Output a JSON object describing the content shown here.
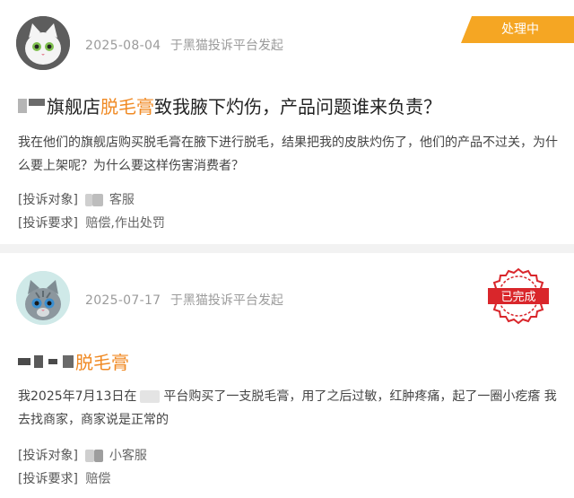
{
  "complaints": [
    {
      "date": "2025-08-04",
      "source": "于黑猫投诉平台发起",
      "status": "处理中",
      "title_mid": "旗舰店",
      "title_highlight": "脱毛膏",
      "title_tail": "致我腋下灼伤，产品问题谁来负责？",
      "body": "我在他们的旗舰店购买脱毛膏在腋下进行脱毛，结果把我的皮肤灼伤了，他们的产品不过关，为什么要上架呢？为什么要这样伤害消费者？",
      "target_label": "[投诉对象]",
      "target_value": "客服",
      "demand_label": "[投诉要求]",
      "demand_value": "赔偿,作出处罚"
    },
    {
      "date": "2025-07-17",
      "source": "于黑猫投诉平台发起",
      "status": "已完成",
      "title_highlight": "脱毛膏",
      "body_prefix": "我2025年7月13日在",
      "body_suffix": "平台购买了一支脱毛膏，用了之后过敏，红肿疼痛，起了一圈小疙瘩 我去找商家，商家说是正常的",
      "target_label": "[投诉对象]",
      "target_value": "小客服",
      "demand_label": "[投诉要求]",
      "demand_value": "赔偿"
    }
  ],
  "colors": {
    "accent": "#f08a24",
    "ribbon": "#f5a623",
    "stamp": "#d9262b",
    "divider": "#f2f2f2"
  }
}
